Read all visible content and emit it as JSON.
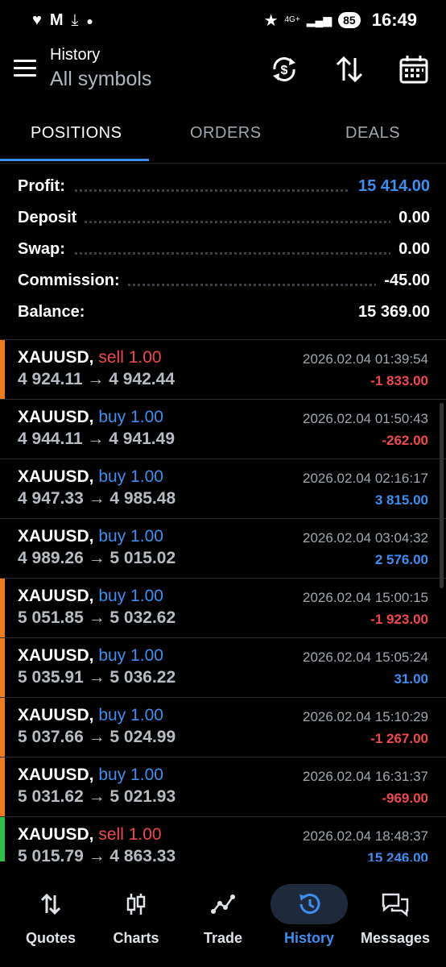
{
  "status": {
    "time": "16:49",
    "battery": "85",
    "network": "4G+"
  },
  "header": {
    "title": "History",
    "subtitle": "All symbols"
  },
  "tabs": [
    {
      "label": "POSITIONS",
      "active": true
    },
    {
      "label": "ORDERS",
      "active": false
    },
    {
      "label": "DEALS",
      "active": false
    }
  ],
  "summary": {
    "profit_label": "Profit:",
    "profit": "15 414.00",
    "deposit_label": "Deposit",
    "deposit": "0.00",
    "swap_label": "Swap:",
    "swap": "0.00",
    "commission_label": "Commission:",
    "commission": "-45.00",
    "balance_label": "Balance:",
    "balance": "15 369.00"
  },
  "deals": [
    {
      "symbol": "XAUUSD,",
      "side": "sell 1.00",
      "type": "sell",
      "prices": "4 924.11 → 4 942.44",
      "time": "2026.02.04 01:39:54",
      "profit": "-1 833.00",
      "bar": "#f07a1e"
    },
    {
      "symbol": "XAUUSD,",
      "side": "buy 1.00",
      "type": "buy",
      "prices": "4 944.11 → 4 941.49",
      "time": "2026.02.04 01:50:43",
      "profit": "-262.00",
      "bar": ""
    },
    {
      "symbol": "XAUUSD,",
      "side": "buy 1.00",
      "type": "buy",
      "prices": "4 947.33 → 4 985.48",
      "time": "2026.02.04 02:16:17",
      "profit": "3 815.00",
      "bar": ""
    },
    {
      "symbol": "XAUUSD,",
      "side": "buy 1.00",
      "type": "buy",
      "prices": "4 989.26 → 5 015.02",
      "time": "2026.02.04 03:04:32",
      "profit": "2 576.00",
      "bar": ""
    },
    {
      "symbol": "XAUUSD,",
      "side": "buy 1.00",
      "type": "buy",
      "prices": "5 051.85 → 5 032.62",
      "time": "2026.02.04 15:00:15",
      "profit": "-1 923.00",
      "bar": "#f07a1e"
    },
    {
      "symbol": "XAUUSD,",
      "side": "buy 1.00",
      "type": "buy",
      "prices": "5 035.91 → 5 036.22",
      "time": "2026.02.04 15:05:24",
      "profit": "31.00",
      "bar": "#f07a1e"
    },
    {
      "symbol": "XAUUSD,",
      "side": "buy 1.00",
      "type": "buy",
      "prices": "5 037.66 → 5 024.99",
      "time": "2026.02.04 15:10:29",
      "profit": "-1 267.00",
      "bar": "#f07a1e"
    },
    {
      "symbol": "XAUUSD,",
      "side": "buy 1.00",
      "type": "buy",
      "prices": "5 031.62 → 5 021.93",
      "time": "2026.02.04 16:31:37",
      "profit": "-969.00",
      "bar": "#f07a1e"
    },
    {
      "symbol": "XAUUSD,",
      "side": "sell 1.00",
      "type": "sell",
      "prices": "5 015.79 → 4 863.33",
      "time": "2026.02.04 18:48:37",
      "profit": "15 246.00",
      "bar": "#2fbf4a"
    }
  ],
  "nav": [
    {
      "label": "Quotes",
      "icon": "quotes-icon"
    },
    {
      "label": "Charts",
      "icon": "charts-icon"
    },
    {
      "label": "Trade",
      "icon": "trade-icon"
    },
    {
      "label": "History",
      "icon": "history-icon",
      "active": true
    },
    {
      "label": "Messages",
      "icon": "messages-icon"
    }
  ],
  "colors": {
    "accent": "#3d8ef0",
    "loss": "#f0484b",
    "bar_orange": "#f07a1e",
    "bar_green": "#2fbf4a"
  }
}
